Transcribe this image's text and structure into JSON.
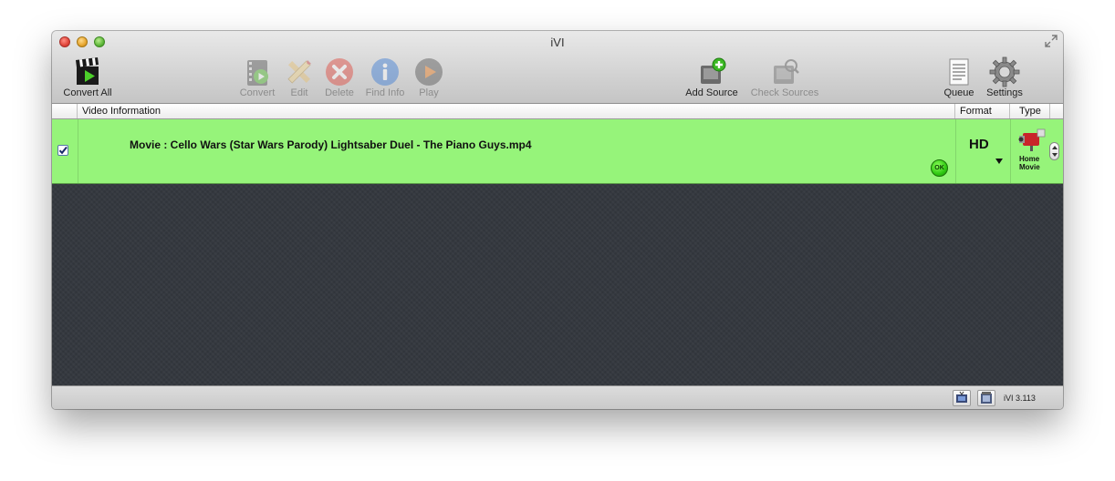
{
  "window": {
    "title": "iVI"
  },
  "toolbar": {
    "convert_all": "Convert All",
    "convert": "Convert",
    "edit": "Edit",
    "delete": "Delete",
    "find_info": "Find Info",
    "play": "Play",
    "add_source": "Add Source",
    "check_sources": "Check Sources",
    "queue": "Queue",
    "settings": "Settings"
  },
  "table": {
    "columns": {
      "video_information": "Video Information",
      "format": "Format",
      "type": "Type"
    },
    "rows": [
      {
        "checked": true,
        "title": "Movie : Cello Wars (Star Wars Parody) Lightsaber Duel - The Piano Guys.mp4",
        "status": "OK",
        "format": "HD",
        "type_line1": "Home",
        "type_line2": "Movie"
      }
    ]
  },
  "status": {
    "version": "iVI 3.113"
  },
  "colors": {
    "row_highlight": "#96f47a",
    "content_bg": "#353940",
    "ok_green": "#2fc812"
  },
  "icons": {
    "convert_all": "clapperboard-icon",
    "convert": "film-play-icon",
    "edit": "pencil-ruler-icon",
    "delete": "delete-x-icon",
    "find_info": "info-icon",
    "play": "play-icon",
    "add_source": "add-drive-icon",
    "check_sources": "check-drive-icon",
    "queue": "document-list-icon",
    "settings": "gear-icon",
    "type": "camcorder-icon"
  }
}
